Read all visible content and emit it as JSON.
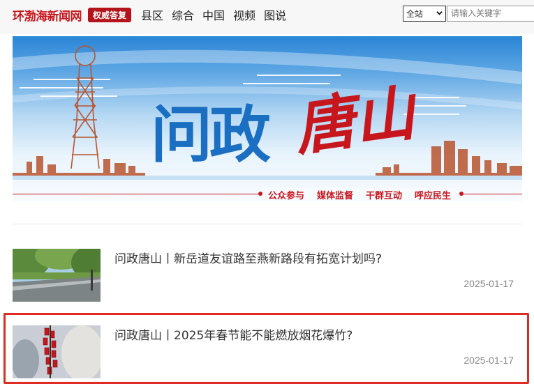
{
  "header": {
    "logo": "环渤海新闻网",
    "badge": "权威答复",
    "nav": [
      "县区",
      "综合",
      "中国",
      "视频",
      "图说"
    ],
    "scope_selected": "全站",
    "search_placeholder": "请输入关键字"
  },
  "banner": {
    "title_main": "问政",
    "title_script": "唐山",
    "slogans": [
      "公众参与",
      "媒体监督",
      "干群互动",
      "呼应民生"
    ]
  },
  "news": [
    {
      "title": "问政唐山丨新岳道友谊路至燕新路段有拓宽计划吗?",
      "date": "2025-01-17"
    },
    {
      "title": "问政唐山丨2025年春节能不能燃放烟花爆竹?",
      "date": "2025-01-17"
    }
  ],
  "colors": {
    "brand_red": "#c8161d",
    "title_blue": "#1a6fc2",
    "highlight_red": "#e02a24"
  }
}
